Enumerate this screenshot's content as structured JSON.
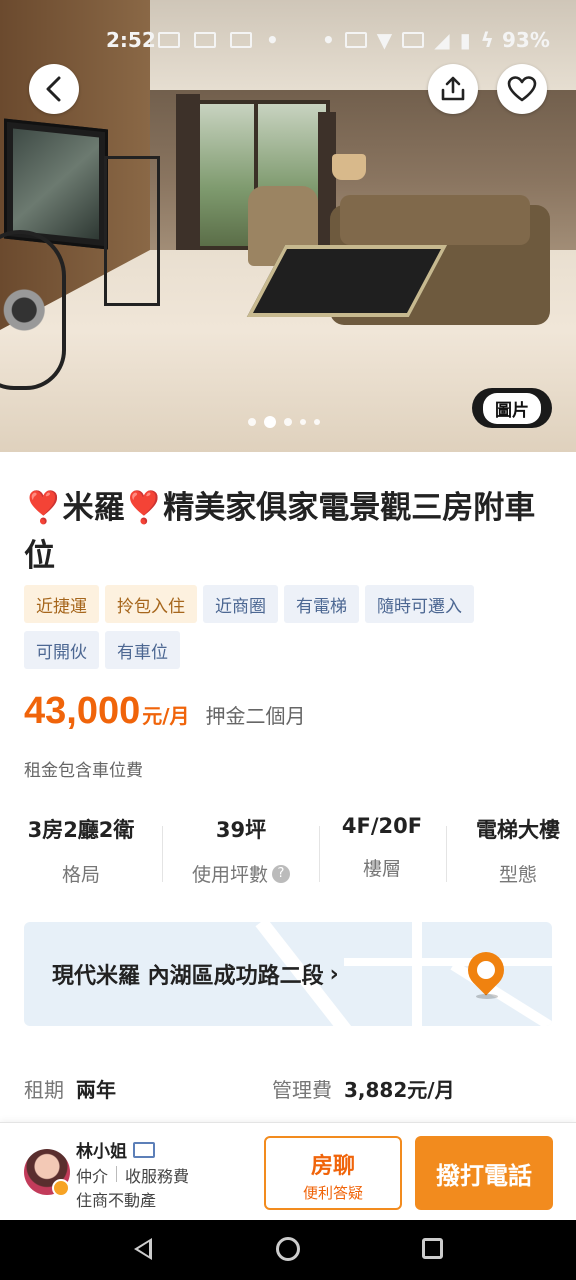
{
  "status_bar": {
    "time": "2:52",
    "battery": "93%"
  },
  "hero": {
    "photo_tag": "圖片",
    "carousel": {
      "current": 2,
      "total": 5
    }
  },
  "listing": {
    "title": "❣️米羅❣️精美家俱家電景觀三房附車位",
    "tags": [
      {
        "label": "近捷運",
        "style": "orange"
      },
      {
        "label": "拎包入住",
        "style": "orange"
      },
      {
        "label": "近商圈",
        "style": "blue"
      },
      {
        "label": "有電梯",
        "style": "blue"
      },
      {
        "label": "隨時可遷入",
        "style": "blue"
      },
      {
        "label": "可開伙",
        "style": "blue"
      },
      {
        "label": "有車位",
        "style": "blue"
      }
    ],
    "price": "43,000",
    "price_unit": "元/月",
    "deposit": "押金二個月",
    "rent_note": "租金包含車位費"
  },
  "specs": [
    {
      "value": "3房2廳2衛",
      "label": "格局"
    },
    {
      "value": "39坪",
      "label": "使用坪數"
    },
    {
      "value": "4F/20F",
      "label": "樓層"
    },
    {
      "value": "電梯大樓",
      "label": "型態"
    }
  ],
  "location": {
    "text": "現代米羅 內湖區成功路二段",
    "chevron": "›"
  },
  "info": {
    "lease_label": "租期",
    "lease_value": "兩年",
    "fee_label": "管理費",
    "fee_value": "3,882元/月"
  },
  "agent": {
    "name": "林小姐",
    "role": "仲介",
    "service": "收服務費",
    "company": "住商不動產"
  },
  "actions": {
    "chat_title": "房聊",
    "chat_sub": "便利答疑",
    "call": "撥打電話"
  },
  "colors": {
    "accent": "#f0640a",
    "button_orange": "#f28b1e"
  }
}
